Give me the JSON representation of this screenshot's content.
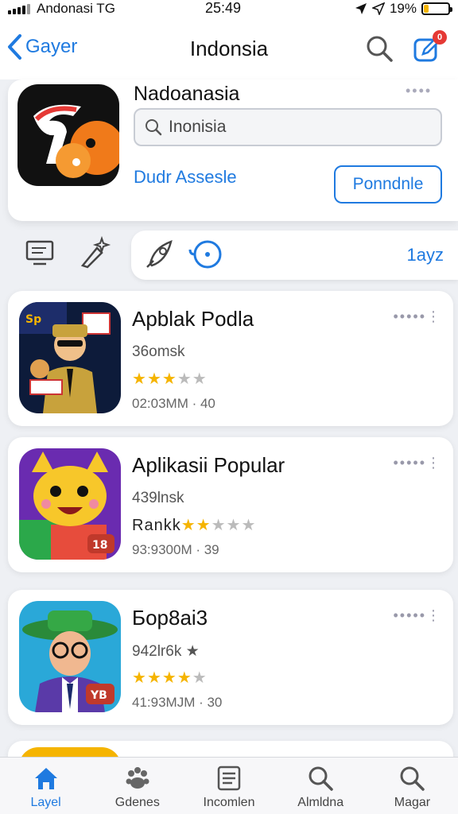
{
  "status_bar": {
    "carrier": "Andonasi TG",
    "time": "25:49",
    "battery": "19%",
    "battery_level": 0.19
  },
  "nav": {
    "back_label": "Gayer",
    "title": "Indonsia",
    "notification_count": "0"
  },
  "header": {
    "title": "Nadoanasia",
    "search_value": "Inonisia",
    "link_label": "Dudr Assesle",
    "button_label": "Ponndnle"
  },
  "toolbar": {
    "count": "1ayz"
  },
  "apps": [
    {
      "name": "Apblak Podla",
      "subtitle": "36omsk",
      "rating": 3,
      "rating_label": "",
      "meta": "02:03MM · 40"
    },
    {
      "name": "Aplikasii Popular",
      "subtitle": "439lnsk",
      "rating": 2,
      "rating_label": "Rankk",
      "meta": "93:9300M · 39"
    },
    {
      "name": "Бор8аі3",
      "subtitle": "942lr6k ★",
      "rating": 3.5,
      "rating_label": "",
      "meta": "41:93MJM · 30"
    }
  ],
  "tabs": [
    {
      "label": "Layel",
      "icon": "home-icon",
      "active": true
    },
    {
      "label": "Gdenes",
      "icon": "paw-icon",
      "active": false
    },
    {
      "label": "Incomlen",
      "icon": "list-icon",
      "active": false
    },
    {
      "label": "Almldna",
      "icon": "search-icon",
      "active": false
    },
    {
      "label": "Magar",
      "icon": "search-icon",
      "active": false
    }
  ],
  "colors": {
    "accent": "#1f7ae0",
    "star": "#f5b400",
    "badge": "#e53935"
  }
}
